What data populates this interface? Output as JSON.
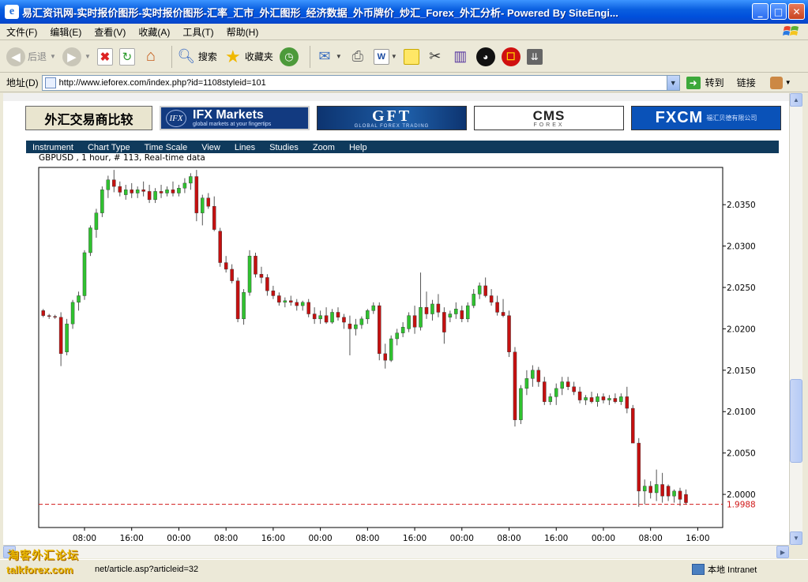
{
  "window": {
    "title": "易汇资讯网-实时报价图形-实时报价图形-汇率_汇市_外汇图形_经济数据_外币牌价_炒汇_Forex_外汇分析- Powered By SiteEngi..."
  },
  "menu": [
    "文件(F)",
    "编辑(E)",
    "查看(V)",
    "收藏(A)",
    "工具(T)",
    "帮助(H)"
  ],
  "toolbar": {
    "back_label": "后退",
    "search_label": "搜索",
    "favorites_label": "收藏夹"
  },
  "address": {
    "label": "地址(D)",
    "url": "http://www.ieforex.com/index.php?id=1108styleid=101",
    "go_label": "转到",
    "links_label": "链接"
  },
  "banners": {
    "b1": "外汇交易商比较",
    "b2_logo": "IFX",
    "b2_title": "IFX Markets",
    "b2_sub": "global markets at your fingertips",
    "b3_title": "GFT",
    "b3_sub": "GLOBAL FOREX TRADING",
    "b4_title": "CMS",
    "b4_sub": "FOREX",
    "b5_title": "FXCM",
    "b5_sub": "福汇贝德有限公司"
  },
  "chart_menu": [
    "Instrument",
    "Chart Type",
    "Time Scale",
    "View",
    "Lines",
    "Studies",
    "Zoom",
    "Help"
  ],
  "chart_header": "GBPUSD , 1 hour, # 113, Real-time data",
  "chart_data": {
    "type": "candlestick",
    "instrument": "GBPUSD",
    "interval": "1 hour",
    "bars": 113,
    "ylim": [
      1.996,
      2.0395
    ],
    "yticks": [
      "2.0350",
      "2.0300",
      "2.0250",
      "2.0200",
      "2.0150",
      "2.0100",
      "2.0050",
      "2.0000"
    ],
    "xticks": [
      "08:00",
      "16:00",
      "00:00",
      "08:00",
      "16:00",
      "00:00",
      "08:00",
      "16:00",
      "00:00",
      "08:00",
      "16:00",
      "00:00",
      "08:00",
      "16:00",
      "00:00"
    ],
    "current_price": "1.9988",
    "colors": {
      "up": "#2fc22f",
      "down": "#c41010",
      "wick": "#555555",
      "current_line": "#d01818"
    },
    "candles": [
      [
        2.0222,
        2.0224,
        2.0214,
        2.0216
      ],
      [
        2.0216,
        2.0218,
        2.0212,
        2.0215
      ],
      [
        2.0215,
        2.0217,
        2.0212,
        2.0214
      ],
      [
        2.0214,
        2.022,
        2.0155,
        2.017
      ],
      [
        2.0172,
        2.0212,
        2.0168,
        2.0206
      ],
      [
        2.0206,
        2.0235,
        2.02,
        2.0232
      ],
      [
        2.0232,
        2.0245,
        2.0222,
        2.024
      ],
      [
        2.024,
        2.0295,
        2.0235,
        2.0292
      ],
      [
        2.0292,
        2.0325,
        2.0288,
        2.0322
      ],
      [
        2.032,
        2.0345,
        2.031,
        2.034
      ],
      [
        2.034,
        2.0372,
        2.0335,
        2.0368
      ],
      [
        2.0368,
        2.0385,
        2.0358,
        2.038
      ],
      [
        2.038,
        2.0392,
        2.0365,
        2.0372
      ],
      [
        2.0372,
        2.0378,
        2.036,
        2.0365
      ],
      [
        2.0362,
        2.0374,
        2.0356,
        2.0368
      ],
      [
        2.0368,
        2.0376,
        2.0358,
        2.0364
      ],
      [
        2.0364,
        2.0372,
        2.0358,
        2.0368
      ],
      [
        2.0368,
        2.0378,
        2.036,
        2.0366
      ],
      [
        2.0366,
        2.0374,
        2.0352,
        2.0356
      ],
      [
        2.0356,
        2.037,
        2.0352,
        2.0366
      ],
      [
        2.0366,
        2.0374,
        2.0358,
        2.0364
      ],
      [
        2.0364,
        2.0372,
        2.036,
        2.0368
      ],
      [
        2.0368,
        2.0378,
        2.036,
        2.0364
      ],
      [
        2.0364,
        2.0374,
        2.036,
        2.037
      ],
      [
        2.037,
        2.0382,
        2.0364,
        2.0376
      ],
      [
        2.0376,
        2.0388,
        2.0368,
        2.0384
      ],
      [
        2.0384,
        2.0392,
        2.033,
        2.034
      ],
      [
        2.034,
        2.0362,
        2.0325,
        2.0358
      ],
      [
        2.0358,
        2.0364,
        2.0345,
        2.0348
      ],
      [
        2.0348,
        2.036,
        2.0318,
        2.032
      ],
      [
        2.0318,
        2.0322,
        2.0275,
        2.028
      ],
      [
        2.028,
        2.0288,
        2.0268,
        2.0272
      ],
      [
        2.0272,
        2.0278,
        2.0255,
        2.0258
      ],
      [
        2.0258,
        2.0262,
        2.0208,
        2.0212
      ],
      [
        2.0212,
        2.0248,
        2.0205,
        2.0244
      ],
      [
        2.0244,
        2.0295,
        2.024,
        2.0288
      ],
      [
        2.0288,
        2.0292,
        2.0262,
        2.0266
      ],
      [
        2.0266,
        2.0275,
        2.0255,
        2.0262
      ],
      [
        2.0262,
        2.0266,
        2.024,
        2.0246
      ],
      [
        2.0246,
        2.0252,
        2.0236,
        2.024
      ],
      [
        2.024,
        2.0244,
        2.0228,
        2.0232
      ],
      [
        2.0232,
        2.0238,
        2.0226,
        2.0234
      ],
      [
        2.0234,
        2.024,
        2.0228,
        2.0232
      ],
      [
        2.0232,
        2.0236,
        2.0222,
        2.0228
      ],
      [
        2.0228,
        2.0234,
        2.0222,
        2.0232
      ],
      [
        2.0232,
        2.0236,
        2.0214,
        2.0218
      ],
      [
        2.0218,
        2.0226,
        2.0206,
        2.0212
      ],
      [
        2.0212,
        2.0222,
        2.0206,
        2.0216
      ],
      [
        2.0216,
        2.0226,
        2.0206,
        2.0208
      ],
      [
        2.0208,
        2.0224,
        2.0206,
        2.022
      ],
      [
        2.022,
        2.0226,
        2.021,
        2.0214
      ],
      [
        2.0214,
        2.0218,
        2.02,
        2.0208
      ],
      [
        2.0206,
        2.0216,
        2.0168,
        2.02
      ],
      [
        2.02,
        2.0212,
        2.0192,
        2.0205
      ],
      [
        2.0205,
        2.0215,
        2.02,
        2.0212
      ],
      [
        2.0212,
        2.0224,
        2.0206,
        2.0222
      ],
      [
        2.0222,
        2.0232,
        2.0218,
        2.0228
      ],
      [
        2.0228,
        2.0232,
        2.0162,
        2.017
      ],
      [
        2.017,
        2.0182,
        2.0152,
        2.0162
      ],
      [
        2.0162,
        2.0192,
        2.016,
        2.0188
      ],
      [
        2.0188,
        2.02,
        2.018,
        2.0195
      ],
      [
        2.0195,
        2.0208,
        2.019,
        2.0202
      ],
      [
        2.02,
        2.022,
        2.0196,
        2.0216
      ],
      [
        2.0216,
        2.0228,
        2.0194,
        2.0202
      ],
      [
        2.0202,
        2.0268,
        2.0198,
        2.0226
      ],
      [
        2.0226,
        2.0245,
        2.0212,
        2.0218
      ],
      [
        2.0218,
        2.0235,
        2.021,
        2.023
      ],
      [
        2.023,
        2.0242,
        2.0214,
        2.022
      ],
      [
        2.022,
        2.0226,
        2.0182,
        2.0196
      ],
      [
        2.0214,
        2.0222,
        2.0208,
        2.0218
      ],
      [
        2.0218,
        2.0232,
        2.0212,
        2.0224
      ],
      [
        2.0222,
        2.0228,
        2.0208,
        2.0212
      ],
      [
        2.0212,
        2.0232,
        2.0208,
        2.0228
      ],
      [
        2.0228,
        2.0248,
        2.0225,
        2.0242
      ],
      [
        2.0242,
        2.0256,
        2.0236,
        2.0252
      ],
      [
        2.0252,
        2.0262,
        2.0238,
        2.024
      ],
      [
        2.024,
        2.0248,
        2.0228,
        2.0232
      ],
      [
        2.0232,
        2.024,
        2.0216,
        2.022
      ],
      [
        2.022,
        2.0236,
        2.0214,
        2.0216
      ],
      [
        2.0216,
        2.0222,
        2.0166,
        2.0172
      ],
      [
        2.0172,
        2.0178,
        2.0082,
        2.009
      ],
      [
        2.009,
        2.0132,
        2.0085,
        2.0128
      ],
      [
        2.0128,
        2.015,
        2.012,
        2.014
      ],
      [
        2.014,
        2.0156,
        2.013,
        2.015
      ],
      [
        2.015,
        2.0154,
        2.013,
        2.0136
      ],
      [
        2.0136,
        2.0142,
        2.0108,
        2.0112
      ],
      [
        2.0112,
        2.0122,
        2.0108,
        2.0118
      ],
      [
        2.0118,
        2.0134,
        2.0108,
        2.0128
      ],
      [
        2.0128,
        2.0142,
        2.012,
        2.0136
      ],
      [
        2.0136,
        2.0142,
        2.0126,
        2.013
      ],
      [
        2.013,
        2.0136,
        2.012,
        2.0124
      ],
      [
        2.0124,
        2.013,
        2.011,
        2.0114
      ],
      [
        2.0114,
        2.012,
        2.0108,
        2.0117
      ],
      [
        2.0117,
        2.0124,
        2.011,
        2.0112
      ],
      [
        2.0112,
        2.0122,
        2.0106,
        2.0118
      ],
      [
        2.0118,
        2.0122,
        2.011,
        2.0114
      ],
      [
        2.0114,
        2.012,
        2.0108,
        2.0116
      ],
      [
        2.0116,
        2.0122,
        2.011,
        2.0112
      ],
      [
        2.0112,
        2.0122,
        2.0108,
        2.0118
      ],
      [
        2.0118,
        2.013,
        2.0098,
        2.0104
      ],
      [
        2.0104,
        2.0108,
        2.0072,
        2.0062
      ],
      [
        2.0062,
        2.0068,
        1.9985,
        2.0004
      ],
      [
        2.0004,
        2.0018,
        1.9988,
        2.001
      ],
      [
        2.001,
        2.0016,
        1.9995,
        2.0002
      ],
      [
        2.0002,
        2.003,
        1.9992,
        2.0012
      ],
      [
        2.0012,
        2.0026,
        1.999,
        1.9998
      ],
      [
        2.001,
        2.0012,
        1.9992,
        1.9998
      ],
      [
        1.9998,
        2.0006,
        1.999,
        2.0004
      ],
      [
        2.0004,
        2.0008,
        1.9986,
        1.9994
      ],
      [
        2.0,
        2.0006,
        1.9988,
        1.999
      ]
    ]
  },
  "status": {
    "url": "net/article.asp?articleid=32",
    "zone": "本地 Intranet"
  },
  "watermark": {
    "line1": "淘客外汇论坛",
    "line2": "talkforex.com"
  }
}
